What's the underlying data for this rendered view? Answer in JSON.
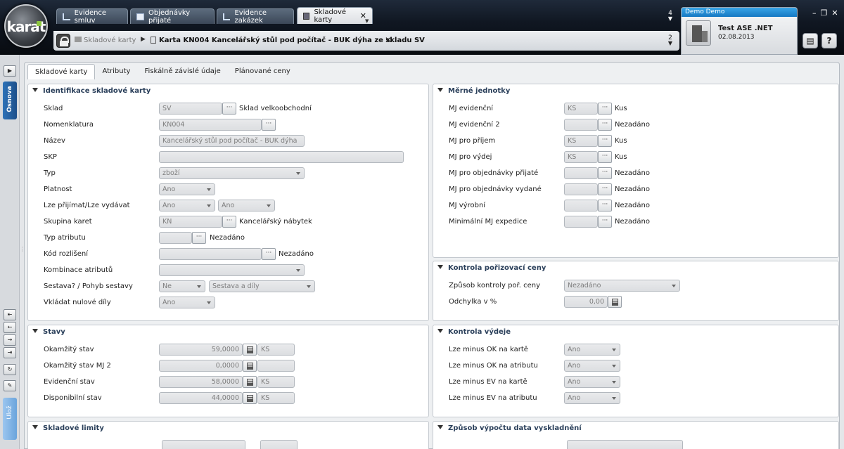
{
  "logo": {
    "text": "karat"
  },
  "tabs": [
    {
      "label": "Evidence smluv"
    },
    {
      "label": "Objednávky přijaté"
    },
    {
      "label": "Evidence zakázek"
    },
    {
      "label": "Skladové karty"
    }
  ],
  "breadcrumb": {
    "parent": "Skladové karty",
    "current": "Karta KN004 Kancelářský stůl pod počítač - BUK dýha ze skladu SV"
  },
  "counters": {
    "top": "4",
    "bottom": "2"
  },
  "user": {
    "name": "Demo Demo",
    "firm": "Test ASE .NET",
    "date": "02.08.2013"
  },
  "rail": {
    "outline": "Osnova",
    "save": "Ulož"
  },
  "inner_tabs": [
    "Skladové karty",
    "Atributy",
    "Fiskálně závislé údaje",
    "Plánované ceny"
  ],
  "ident": {
    "title": "Identifikace skladové karty",
    "sklad": {
      "label": "Sklad",
      "value": "SV",
      "desc": "Sklad velkoobchodní"
    },
    "nomenklatura": {
      "label": "Nomenklatura",
      "value": "KN004"
    },
    "nazev": {
      "label": "Název",
      "value": "Kancelářský stůl pod počítač - BUK dýha"
    },
    "skp": {
      "label": "SKP",
      "value": ""
    },
    "typ": {
      "label": "Typ",
      "value": "zboží"
    },
    "platnost": {
      "label": "Platnost",
      "value": "Ano"
    },
    "prijimat": {
      "label": "Lze přijímat/Lze vydávat",
      "value1": "Ano",
      "value2": "Ano"
    },
    "skupina": {
      "label": "Skupina karet",
      "value": "KN",
      "desc": "Kancelářský nábytek"
    },
    "typ_atributu": {
      "label": "Typ atributu",
      "value": "",
      "desc": "Nezadáno"
    },
    "kod": {
      "label": "Kód rozlišení",
      "value": "",
      "desc": "Nezadáno"
    },
    "kombinace": {
      "label": "Kombinace atributů",
      "value": ""
    },
    "sestava": {
      "label": "Sestava? / Pohyb sestavy",
      "value1": "Ne",
      "value2": "Sestava a díly"
    },
    "nulove": {
      "label": "Vkládat nulové díly",
      "value": "Ano"
    }
  },
  "mj": {
    "title": "Měrné jednotky",
    "rows": [
      {
        "label": "MJ evidenční",
        "value": "KS",
        "desc": "Kus"
      },
      {
        "label": "MJ evidenční 2",
        "value": "",
        "desc": "Nezadáno"
      },
      {
        "label": "MJ pro příjem",
        "value": "KS",
        "desc": "Kus"
      },
      {
        "label": "MJ pro výdej",
        "value": "KS",
        "desc": "Kus"
      },
      {
        "label": "MJ pro objednávky přijaté",
        "value": "",
        "desc": "Nezadáno"
      },
      {
        "label": "MJ pro objednávky vydané",
        "value": "",
        "desc": "Nezadáno"
      },
      {
        "label": "MJ výrobní",
        "value": "",
        "desc": "Nezadáno"
      },
      {
        "label": "Minimální MJ expedice",
        "value": "",
        "desc": "Nezadáno"
      }
    ]
  },
  "kontrola_ceny": {
    "title": "Kontrola pořizovací ceny",
    "zpusob": {
      "label": "Způsob kontroly poř. ceny",
      "value": "Nezadáno"
    },
    "odchylka": {
      "label": "Odchylka v %",
      "value": "0,00"
    }
  },
  "stavy": {
    "title": "Stavy",
    "rows": [
      {
        "label": "Okamžitý stav",
        "value": "59,0000",
        "unit": "KS"
      },
      {
        "label": "Okamžitý stav MJ 2",
        "value": "0,0000",
        "unit": ""
      },
      {
        "label": "Evidenční stav",
        "value": "58,0000",
        "unit": "KS"
      },
      {
        "label": "Disponibilní stav",
        "value": "44,0000",
        "unit": "KS"
      }
    ]
  },
  "kontrola_vydeje": {
    "title": "Kontrola výdeje",
    "rows": [
      {
        "label": "Lze minus OK na kartě",
        "value": "Ano"
      },
      {
        "label": "Lze minus OK na atributu",
        "value": "Ano"
      },
      {
        "label": "Lze minus EV na kartě",
        "value": "Ano"
      },
      {
        "label": "Lze minus EV na atributu",
        "value": "Ano"
      }
    ]
  },
  "limity": {
    "title": "Skladové limity"
  },
  "vyskladneni": {
    "title": "Způsob výpočtu data vyskladnění"
  },
  "buttons": {
    "ellipsis": "···",
    "help": "?"
  }
}
